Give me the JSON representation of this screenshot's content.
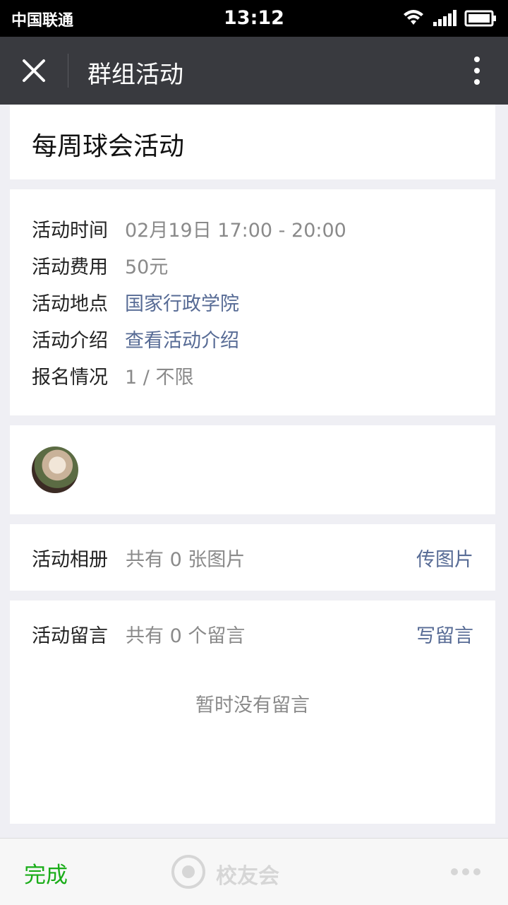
{
  "status_bar": {
    "carrier": "中国联通",
    "time": "13:12",
    "icons": [
      "wifi-icon",
      "signal-icon",
      "battery-icon"
    ]
  },
  "nav": {
    "title": "群组活动",
    "close_icon": "close-icon",
    "more_icon": "more-vertical-icon"
  },
  "event": {
    "title": "每周球会活动"
  },
  "info": {
    "rows": [
      {
        "label": "活动时间",
        "value": "02月19日 17:00 - 20:00"
      },
      {
        "label": "活动费用",
        "value": "50元"
      },
      {
        "label": "活动地点",
        "value": "国家行政学院"
      },
      {
        "label": "活动介绍",
        "value": "查看活动介绍"
      },
      {
        "label": "报名情况",
        "value": "1 / 不限"
      }
    ]
  },
  "album": {
    "label": "活动相册",
    "count": "共有 0 张图片",
    "action": "传图片"
  },
  "comments": {
    "label": "活动留言",
    "count": "共有 0 个留言",
    "action": "写留言",
    "empty": "暂时没有留言"
  },
  "bottom": {
    "done": "完成",
    "watermark": "校友会"
  },
  "colors": {
    "nav_bg": "#393a3f",
    "link": "#576b95",
    "accent_green": "#1aad19",
    "secondary_text": "#8a8a8a"
  }
}
